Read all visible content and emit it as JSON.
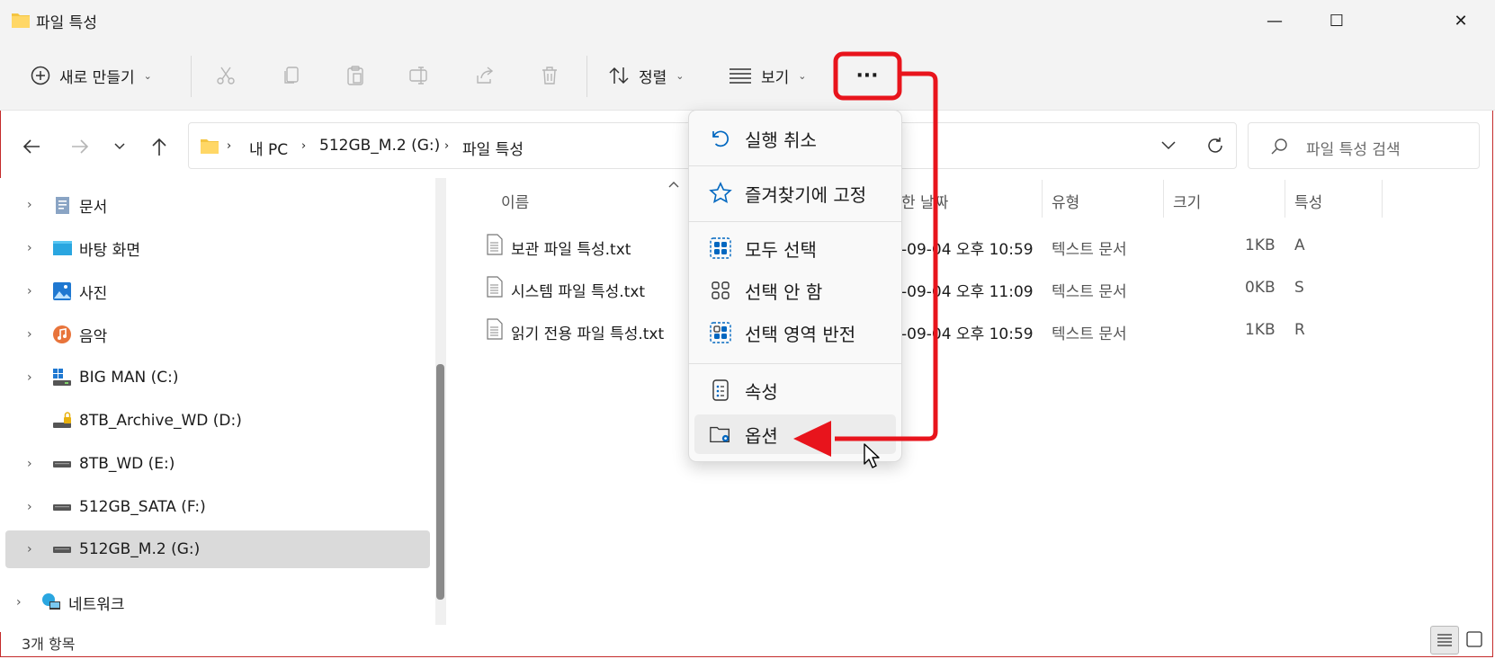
{
  "window": {
    "title": "파일 특성",
    "minimize": "—",
    "maximize": "☐",
    "close": "✕"
  },
  "toolbar": {
    "new_label": "새로 만들기",
    "sort_label": "정렬",
    "view_label": "보기",
    "more_label": "···"
  },
  "address": {
    "crumbs": [
      "내 PC",
      "512GB_M.2 (G:)",
      "파일 특성"
    ],
    "search_placeholder": "파일 특성 검색"
  },
  "sidebar": {
    "items": [
      {
        "label": "문서",
        "icon": "documents-icon"
      },
      {
        "label": "바탕 화면",
        "icon": "desktop-icon"
      },
      {
        "label": "사진",
        "icon": "pictures-icon"
      },
      {
        "label": "음악",
        "icon": "music-icon"
      },
      {
        "label": "BIG MAN (C:)",
        "icon": "system-drive-icon"
      },
      {
        "label": "8TB_Archive_WD (D:)",
        "icon": "locked-drive-icon"
      },
      {
        "label": "8TB_WD (E:)",
        "icon": "drive-icon"
      },
      {
        "label": "512GB_SATA (F:)",
        "icon": "drive-icon"
      },
      {
        "label": "512GB_M.2 (G:)",
        "icon": "drive-icon"
      },
      {
        "label": "네트워크",
        "icon": "network-icon"
      }
    ]
  },
  "columns": {
    "name": "이름",
    "date": "한 날짜",
    "type": "유형",
    "size": "크기",
    "attr": "특성"
  },
  "files": [
    {
      "name": "보관 파일 특성.txt",
      "date": "-09-04 오후 10:59",
      "type": "텍스트 문서",
      "size": "1KB",
      "attr": "A"
    },
    {
      "name": "시스템 파일 특성.txt",
      "date": "-09-04 오후 11:09",
      "type": "텍스트 문서",
      "size": "0KB",
      "attr": "S"
    },
    {
      "name": "읽기 전용 파일 특성.txt",
      "date": "-09-04 오후 10:59",
      "type": "텍스트 문서",
      "size": "1KB",
      "attr": "R"
    }
  ],
  "menu": {
    "undo": "실행 취소",
    "pin": "즐겨찾기에 고정",
    "select_all": "모두 선택",
    "select_none": "선택 안 함",
    "invert": "선택 영역 반전",
    "properties": "속성",
    "options": "옵션"
  },
  "status": {
    "count": "3개 항목"
  },
  "colors": {
    "annotation": "#e8141c",
    "accent": "#0067c0",
    "folder": "#f4c542"
  }
}
